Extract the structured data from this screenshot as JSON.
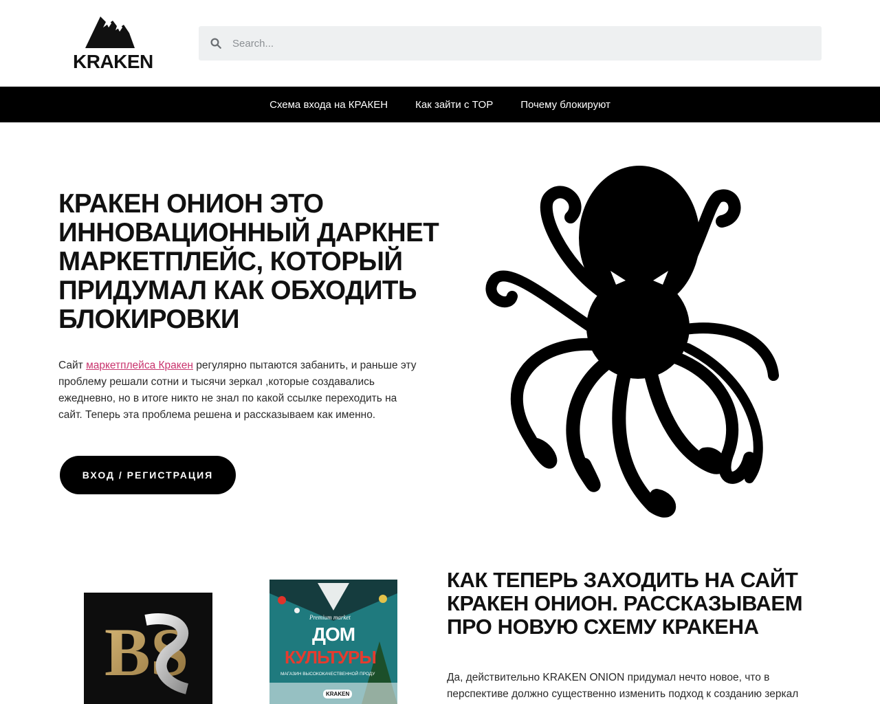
{
  "header": {
    "logo_text": "KRAKEN",
    "search_placeholder": "Search..."
  },
  "nav": {
    "items": [
      {
        "label": "Схема входа на КРАКЕН"
      },
      {
        "label": "Как зайти с TOP"
      },
      {
        "label": "Почему блокируют"
      }
    ]
  },
  "hero": {
    "title": "КРАКЕН ОНИОН ЭТО ИННОВАЦИОННЫЙ ДАРКНЕТ МАРКЕТПЛЕЙС, КОТОРЫЙ ПРИДУМАЛ КАК ОБХОДИТЬ БЛОКИРОВКИ",
    "text_before_link": "Сайт ",
    "link_text": "маркетплейса Кракен",
    "text_after_link": " регулярно пытаются забанить, и раньше эту проблему решали сотни и тысячи зеркал ,которые создавались ежедневно, но в итоге никто не знал по какой ссылке переходить на сайт. Теперь эта проблема решена и рассказываем как именно.",
    "cta_label": "ВХОД / РЕГИСТРАЦИЯ"
  },
  "section2": {
    "title": "КАК ТЕПЕРЬ ЗАХОДИТЬ НА САЙТ КРАКЕН ОНИОН. РАССКАЗЫВАЕМ ПРО НОВУЮ СХЕМУ КРАКЕНА",
    "text": "Да, действительно KRAKEN ONION придумал нечто новое, что в перспективе должно существенно изменить подход к созданию зеркал",
    "card_bs": {
      "letters": "BS"
    },
    "card_dom": {
      "script_text": "Premium market",
      "line1": "ДОМ",
      "line2": "КУЛЬТУРЫ",
      "subtitle": "МАГАЗИН ВЫСОКОКАЧЕСТВЕННОЙ ПРОДУ",
      "badge": "KRAKEN"
    }
  },
  "colors": {
    "accent_link": "#c9346e",
    "nav_bg": "#000000",
    "search_bg": "#eef0f1"
  }
}
